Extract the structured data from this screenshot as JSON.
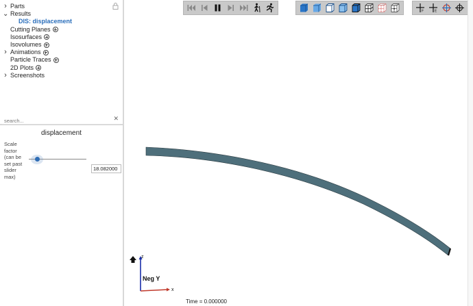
{
  "tree": {
    "items": [
      {
        "label": "Parts",
        "chevron": "right",
        "level": 0,
        "add": false
      },
      {
        "label": "Results",
        "chevron": "down",
        "level": 0,
        "add": false
      },
      {
        "label": "DIS: displacement",
        "chevron": "",
        "level": 2,
        "add": false
      },
      {
        "label": "Cutting Planes",
        "chevron": "",
        "level": 1,
        "add": true
      },
      {
        "label": "Isosurfaces",
        "chevron": "",
        "level": 1,
        "add": true
      },
      {
        "label": "Isovolumes",
        "chevron": "",
        "level": 1,
        "add": true
      },
      {
        "label": "Animations",
        "chevron": "right",
        "level": 0,
        "add": true
      },
      {
        "label": "Particle Traces",
        "chevron": "",
        "level": 1,
        "add": true
      },
      {
        "label": "2D Plots",
        "chevron": "",
        "level": 1,
        "add": true
      },
      {
        "label": "Screenshots",
        "chevron": "right",
        "level": 0,
        "add": false
      }
    ]
  },
  "search": {
    "placeholder": "search...",
    "value": ""
  },
  "properties": {
    "title": "displacement",
    "scale_label": "Scale factor (can be set past slider max)",
    "scale_value": "18.082000",
    "slider_fraction": 0.15
  },
  "toolbar_playback": [
    "first-frame-icon",
    "previous-frame-icon",
    "pause-icon",
    "next-frame-icon",
    "last-frame-icon",
    "walk-icon",
    "run-icon"
  ],
  "toolbar_views": [
    "solid-view-icon",
    "smooth-view-icon",
    "outline-view-icon",
    "shaded-edges-icon",
    "wireframe-icon",
    "mesh-icon",
    "hidden-mesh-icon",
    "points-icon"
  ],
  "toolbar_tools": [
    "probe-icon",
    "edge-probe-icon",
    "measure-icon",
    "pick-icon"
  ],
  "viewport": {
    "view_label": "Neg Y",
    "axis_z": "z",
    "axis_x": "x",
    "time_label": "Time = 0.000000",
    "beam_color": "#4e6f7b"
  }
}
